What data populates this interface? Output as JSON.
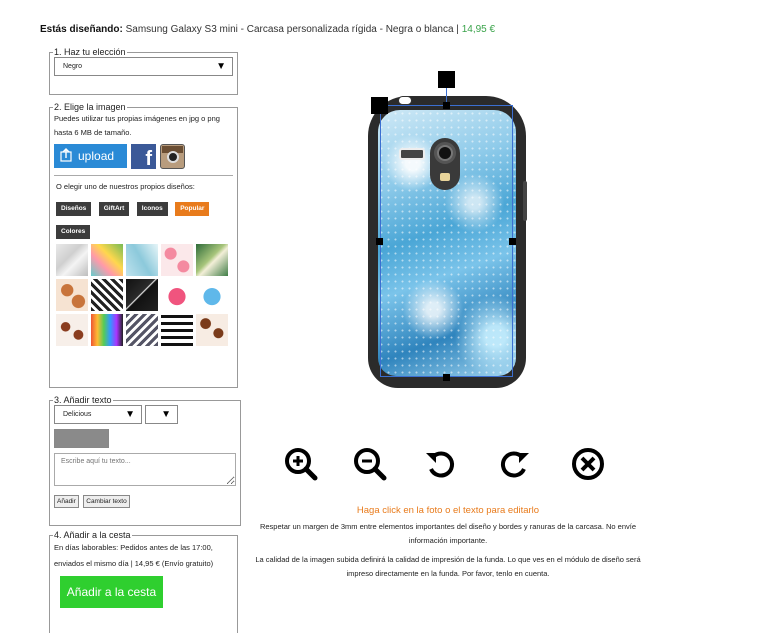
{
  "header": {
    "prefix": "Estás diseñando:",
    "product": "Samsung Galaxy S3 mini - Carcasa personalizada rígida - Negra o blanca |",
    "price": "14,95 €"
  },
  "step1": {
    "legend": "1. Haz tu elección",
    "select_value": "Negro"
  },
  "step2": {
    "legend": "2. Elige la imagen",
    "intro": "Puedes utilizar tus propias imágenes en jpg o png hasta 6 MB de tamaño.",
    "upload_label": "upload",
    "facebook_glyph": "f",
    "or_text": "O elegir uno de nuestros propios diseños:",
    "tags": [
      {
        "label": "Diseños",
        "active": false
      },
      {
        "label": "GiftArt",
        "active": false
      },
      {
        "label": "Iconos",
        "active": false
      },
      {
        "label": "Popular",
        "active": true
      },
      {
        "label": "Colores",
        "active": false
      }
    ]
  },
  "step3": {
    "legend": "3. Añadir texto",
    "font_select": "Delicious",
    "size_select": "",
    "text_placeholder": "Escribe aquí tu texto...",
    "add_button": "Añadir",
    "change_button": "Cambiar texto",
    "color_swatch": "#8a8a8a"
  },
  "step4": {
    "legend": "4. Añadir a la cesta",
    "info": "En días laborables: Pedidos antes de las 17:00, enviados el mismo día | 14,95 € (Envío gratuito)",
    "cart_button": "Añadir a la cesta"
  },
  "notes": {
    "click_hint": "Haga click en la foto o el texto para editarlo",
    "margin_note": "Respetar un margen de 3mm entre elementos importantes del diseño y bordes y ranuras de la carcasa. No envíe información importante.",
    "quality_note": "La calidad de la imagen subida definirá la calidad de impresión de la funda. Lo que ves en el módulo de diseño será impreso directamente en la funda. Por favor, tenlo en cuenta."
  },
  "colors": {
    "accent_orange": "#e87b1c",
    "accent_green": "#2fcf2f",
    "upload_blue": "#2a8ad6",
    "facebook_blue": "#3b5998",
    "tag_dark": "#3c3c3c"
  }
}
